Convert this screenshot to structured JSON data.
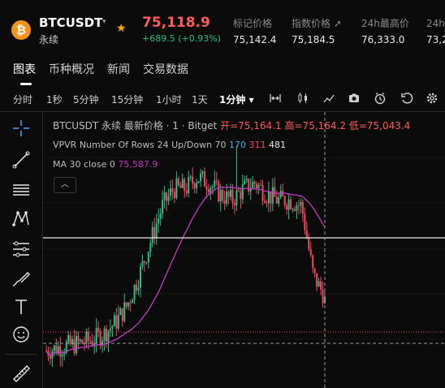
{
  "header": {
    "logo_char": "₿",
    "symbol": "BTCUSDT",
    "type": "永续",
    "price": "75,118.9",
    "change": "+689.5 (+0.93%)",
    "stats": [
      {
        "label": "标记价格",
        "value": "75,142.4"
      },
      {
        "label": "指数价格 ➚",
        "value": "75,184.5"
      },
      {
        "label": "24h最高价",
        "value": "76,333.0"
      },
      {
        "label": "24h最",
        "value": "73,2"
      }
    ]
  },
  "tabs": [
    "图表",
    "币种概况",
    "新闻",
    "交易数据"
  ],
  "intervals": [
    "分时",
    "1秒",
    "5分钟",
    "15分钟",
    "1小时",
    "1天",
    "1分钟 ▾"
  ],
  "legend": {
    "title": "BTCUSDT 永续 最新价格 · 1 · Bitget",
    "open": "开=75,164.1",
    "high": "高=75,164.2",
    "low": "低=75,043.4",
    "vpvr_label": "VPVR Number Of Rows 24 Up/Down 70",
    "vpvr_v1": "170",
    "vpvr_v2": "311",
    "vpvr_v3": "481",
    "ma_label": "MA 30 close 0",
    "ma_value": "75,587.9"
  },
  "colors": {
    "up": "#2ebd85",
    "down": "#f6465d",
    "ma": "#c23bc2",
    "accent": "#f7931a"
  },
  "chart_data": {
    "type": "candlestick",
    "series": [
      {
        "name": "BTCUSDT 1m",
        "close_trend": [
          74650,
          74680,
          74700,
          74720,
          74750,
          74800,
          74900,
          75050,
          75300,
          75600,
          75900,
          76050,
          76050,
          76150,
          76100,
          76000,
          75950,
          76050,
          76100,
          76000,
          75950,
          75950,
          75900,
          75300,
          75118.9
        ]
      },
      {
        "name": "MA 30 close 0",
        "last": 75587.9
      }
    ]
  }
}
